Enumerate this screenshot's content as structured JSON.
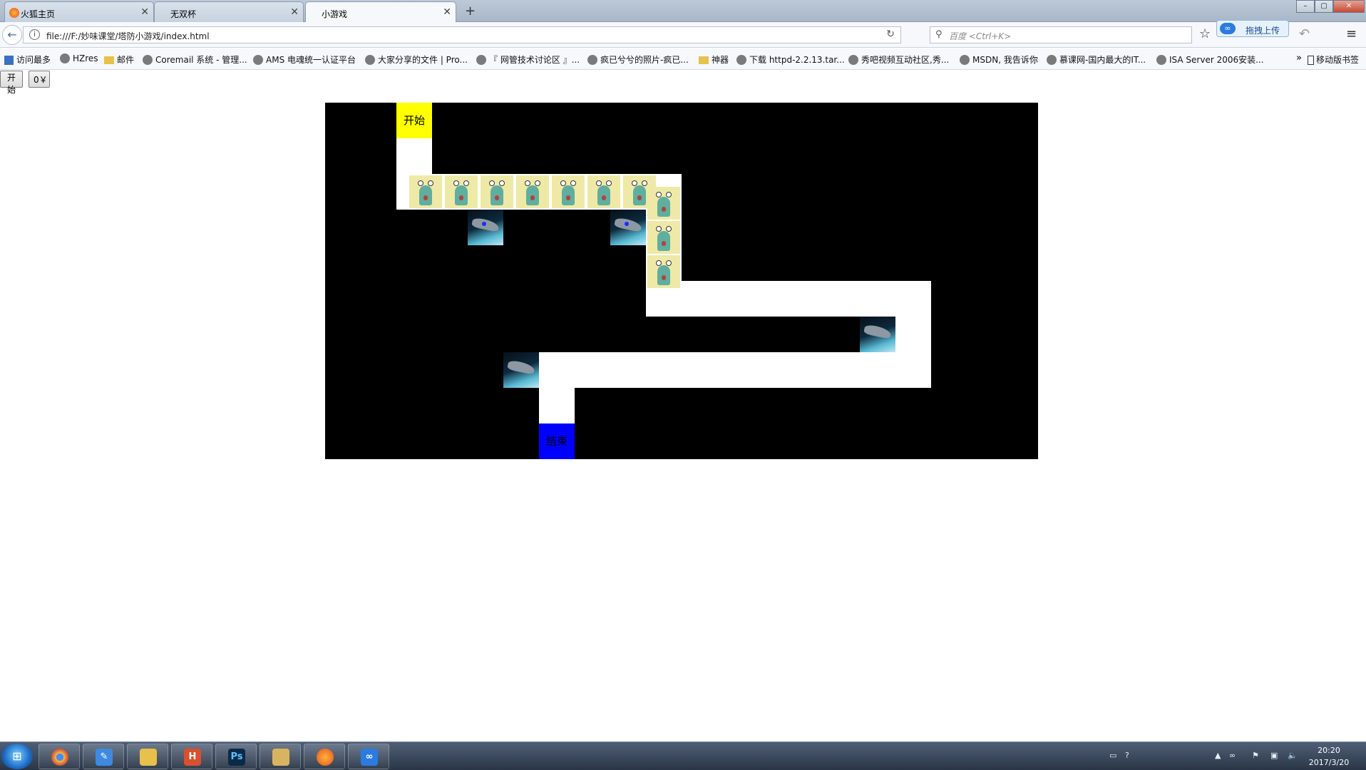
{
  "browser": {
    "tabs": [
      {
        "label": "火狐主页",
        "active": false
      },
      {
        "label": "无双杯",
        "active": false
      },
      {
        "label": "小游戏",
        "active": true
      }
    ],
    "new_tab": "+",
    "url": "file:///F:/妙味课堂/塔防小游戏/index.html",
    "search_placeholder": "百度 <Ctrl+K>",
    "upload_label": "拖拽上传",
    "bookmarks": [
      {
        "label": "访问最多",
        "icon": "bookmark-folder-blue"
      },
      {
        "label": "HZres",
        "icon": "globe-icon"
      },
      {
        "label": "邮件",
        "icon": "folder-icon"
      },
      {
        "label": "Coremail 系统 - 管理...",
        "icon": "globe-icon"
      },
      {
        "label": "AMS 电魂统一认证平台",
        "icon": "globe-icon"
      },
      {
        "label": "大家分享的文件 | Pro...",
        "icon": "globe-icon"
      },
      {
        "label": "『 网管技术讨论区 』...",
        "icon": "globe-icon"
      },
      {
        "label": "疯已兮兮的照片-疯已...",
        "icon": "globe-icon"
      },
      {
        "label": "神器",
        "icon": "folder-icon"
      },
      {
        "label": "下载 httpd-2.2.13.tar...",
        "icon": "globe-icon"
      },
      {
        "label": "秀吧视频互动社区,秀...",
        "icon": "globe-icon"
      },
      {
        "label": "MSDN, 我告诉你",
        "icon": "globe-icon"
      },
      {
        "label": "慕课网-国内最大的IT...",
        "icon": "globe-icon"
      },
      {
        "label": "ISA Server 2006安装...",
        "icon": "globe-icon"
      }
    ],
    "more": "»",
    "mobile_bookmarks": "移动版书签"
  },
  "page": {
    "start_button": "开始",
    "money": "0￥"
  },
  "game": {
    "start_label": "开始",
    "end_label": "结束",
    "colors": {
      "board": "#000000",
      "path": "#ffffff",
      "start": "#ffff00",
      "end": "#0000ff",
      "monster_bg": "#eee9a6"
    },
    "monster_count": 10,
    "tower_count": 4
  },
  "taskbar": {
    "apps": [
      "chrome-icon",
      "note-icon",
      "folder-icon",
      "hbuilder-icon",
      "photoshop-icon",
      "explorer-icon",
      "firefox-icon",
      "baidu-cloud-icon"
    ],
    "time": "20:20",
    "date": "2017/3/20"
  }
}
